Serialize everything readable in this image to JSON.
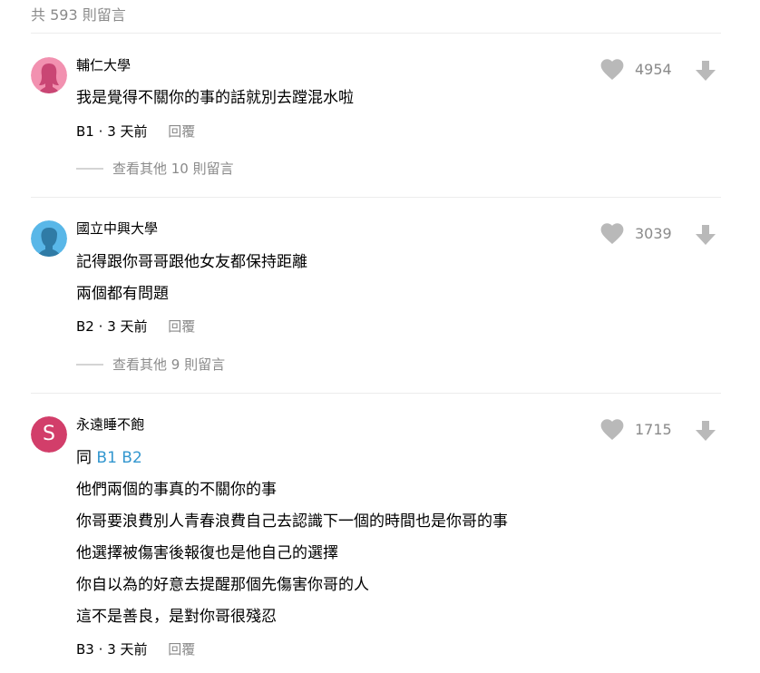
{
  "header": {
    "total_label": "共 593 則留言"
  },
  "comments": [
    {
      "author": "輔仁大學",
      "lines": [
        "我是覺得不關你的事的話就別去蹚混水啦"
      ],
      "floor": "B1",
      "sep": "·",
      "time": "3 天前",
      "reply_label": "回覆",
      "likes": "4954",
      "more_replies": "查看其他 10 則留言",
      "avatar": {
        "type": "female",
        "color": "#f291b0"
      }
    },
    {
      "author": "國立中興大學",
      "lines": [
        "記得跟你哥哥跟他女友都保持距離",
        "兩個都有問題"
      ],
      "floor": "B2",
      "sep": "·",
      "time": "3 天前",
      "reply_label": "回覆",
      "likes": "3039",
      "more_replies": "查看其他 9 則留言",
      "avatar": {
        "type": "male",
        "color": "#59b7e8"
      }
    },
    {
      "author": "永遠睡不飽",
      "first_line_prefix": "同 ",
      "first_line_refs": "B1 B2",
      "lines": [
        "他們兩個的事真的不關你的事",
        "你哥要浪費別人青春浪費自己去認識下一個的時間也是你哥的事",
        "他選擇被傷害後報復也是他自己的選擇",
        "你自以為的好意去提醒那個先傷害你哥的人",
        "這不是善良，是對你哥很殘忍"
      ],
      "floor": "B3",
      "sep": "·",
      "time": "3 天前",
      "reply_label": "回覆",
      "likes": "1715",
      "avatar": {
        "type": "letter",
        "letter": "S",
        "color": "#d23e6a"
      }
    }
  ],
  "icons": {
    "like": "heart-icon",
    "dislike": "arrow-down-icon",
    "icon_color": "#b9b9b9"
  }
}
